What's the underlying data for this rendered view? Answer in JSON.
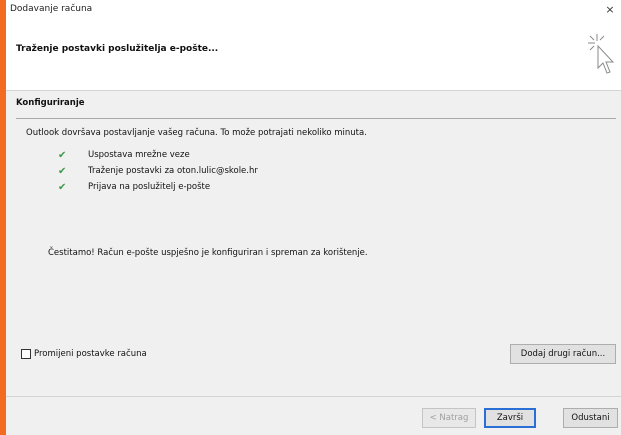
{
  "window": {
    "title": "Dodavanje računa",
    "close_glyph": "×"
  },
  "header": {
    "title": "Traženje postavki poslužitelja e-pošte...",
    "icon": "cursor-click-icon"
  },
  "section": {
    "title": "Konfiguriranje",
    "intro": "Outlook dovršava postavljanje vašeg računa. To može potrajati nekoliko minuta.",
    "steps": [
      {
        "label": "Uspostava mrežne veze",
        "status_glyph": "✔"
      },
      {
        "label": "Traženje postavki za oton.lulic@skole.hr",
        "status_glyph": "✔"
      },
      {
        "label": "Prijava na poslužitelj e-pošte",
        "status_glyph": "✔"
      }
    ],
    "congrats": "Čestitamo! Račun e-pošte uspješno je konfiguriran i spreman za korištenje."
  },
  "options": {
    "change_settings_label": "Promijeni postavke računa",
    "change_settings_checked": false,
    "add_account_label": "Dodaj drugi račun..."
  },
  "footer": {
    "back_label": "< Natrag",
    "finish_label": "Završi",
    "cancel_label": "Odustani"
  },
  "colors": {
    "frame": "#f26b21",
    "check": "#3c9a4a",
    "focus_border": "#2a6fd6"
  }
}
